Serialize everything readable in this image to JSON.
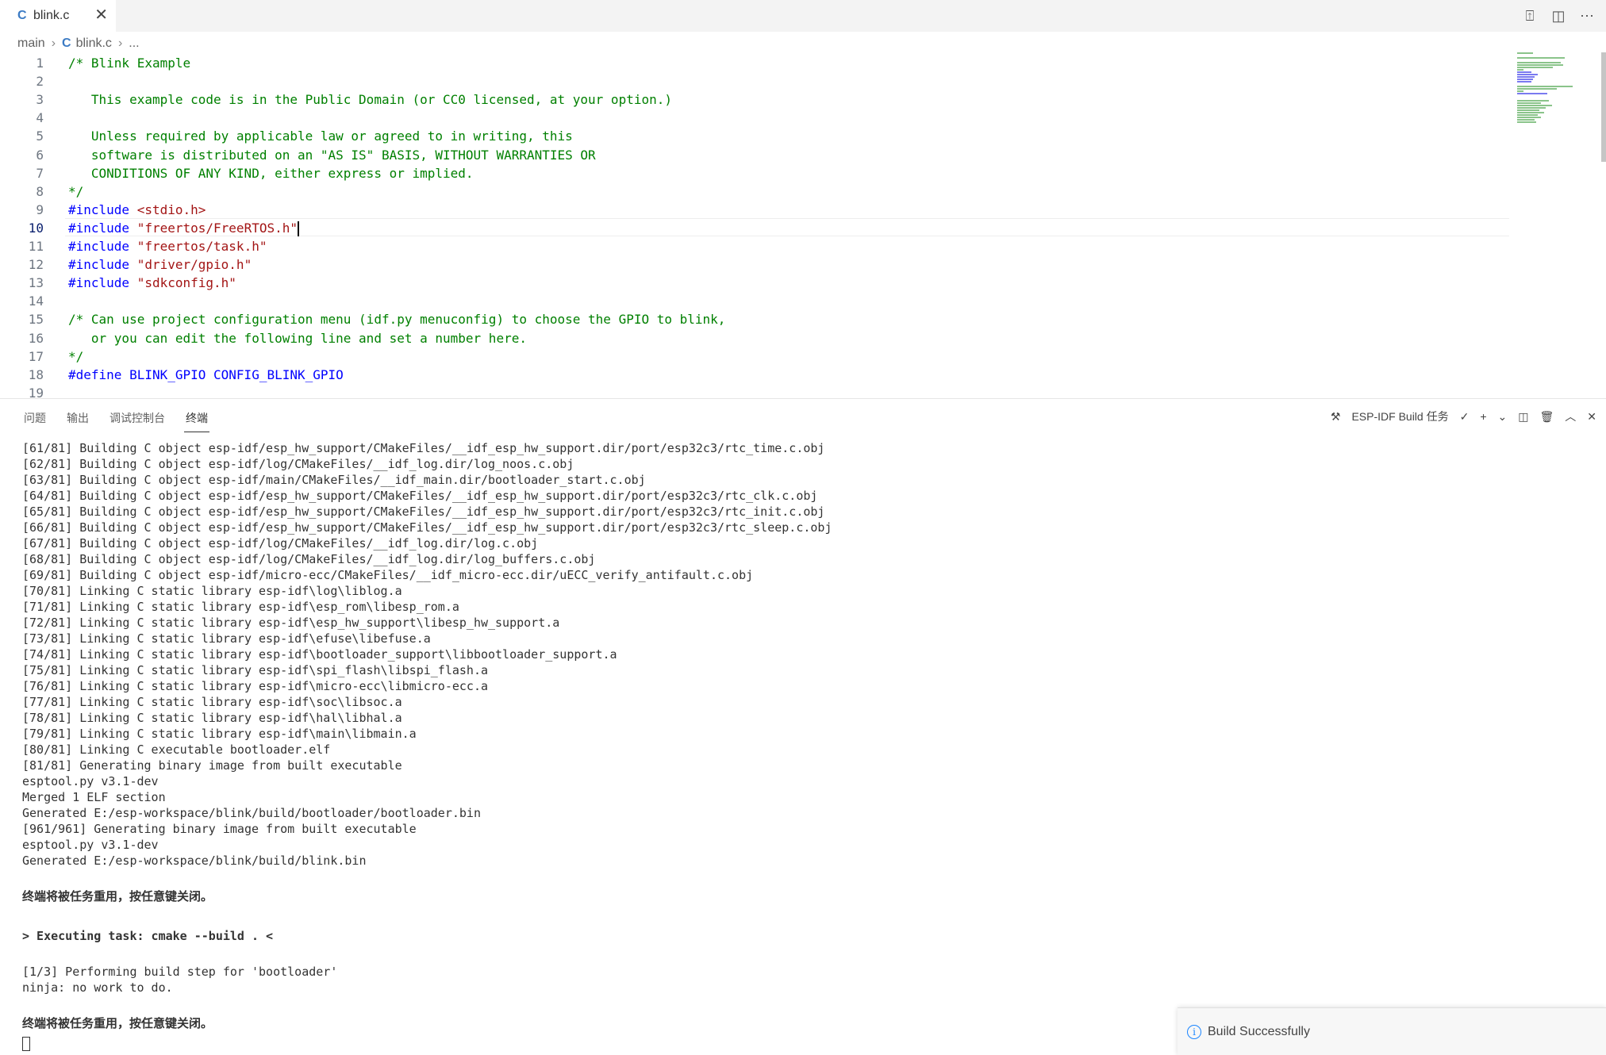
{
  "tab": {
    "icon": "C",
    "label": "blink.c",
    "close": "✕"
  },
  "top_actions": [
    "⍐",
    "◫",
    "⋯"
  ],
  "breadcrumb": {
    "folder": "main",
    "file_icon": "C",
    "file": "blink.c",
    "rest": "..."
  },
  "editor": {
    "lines": [
      {
        "n": "1",
        "text": "/* Blink Example",
        "kind": "comment"
      },
      {
        "n": "2",
        "text": "",
        "kind": "comment"
      },
      {
        "n": "3",
        "text": "   This example code is in the Public Domain (or CC0 licensed, at your option.)",
        "kind": "comment"
      },
      {
        "n": "4",
        "text": "",
        "kind": "comment"
      },
      {
        "n": "5",
        "text": "   Unless required by applicable law or agreed to in writing, this",
        "kind": "comment"
      },
      {
        "n": "6",
        "text": "   software is distributed on an \"AS IS\" BASIS, WITHOUT WARRANTIES OR",
        "kind": "comment"
      },
      {
        "n": "7",
        "text": "   CONDITIONS OF ANY KIND, either express or implied.",
        "kind": "comment"
      },
      {
        "n": "8",
        "text": "*/",
        "kind": "comment"
      },
      {
        "n": "9",
        "pre": "#include ",
        "arg": "<stdio.h>",
        "kind": "include"
      },
      {
        "n": "10",
        "pre": "#include ",
        "arg": "\"freertos/FreeRTOS.h\"",
        "kind": "include",
        "active": true
      },
      {
        "n": "11",
        "pre": "#include ",
        "arg": "\"freertos/task.h\"",
        "kind": "include"
      },
      {
        "n": "12",
        "pre": "#include ",
        "arg": "\"driver/gpio.h\"",
        "kind": "include"
      },
      {
        "n": "13",
        "pre": "#include ",
        "arg": "\"sdkconfig.h\"",
        "kind": "include"
      },
      {
        "n": "14",
        "text": "",
        "kind": "plain"
      },
      {
        "n": "15",
        "text": "/* Can use project configuration menu (idf.py menuconfig) to choose the GPIO to blink,",
        "kind": "comment"
      },
      {
        "n": "16",
        "text": "   or you can edit the following line and set a number here.",
        "kind": "comment"
      },
      {
        "n": "17",
        "text": "*/",
        "kind": "comment"
      },
      {
        "n": "18",
        "text": "#define BLINK_GPIO CONFIG_BLINK_GPIO",
        "kind": "define"
      },
      {
        "n": "19",
        "text": "",
        "kind": "plain"
      }
    ]
  },
  "panel": {
    "tabs": [
      "问题",
      "输出",
      "调试控制台",
      "终端"
    ],
    "active_tab": 3,
    "task_label": "ESP-IDF Build 任务",
    "actions": [
      "✓",
      "+",
      "⌄",
      "◫",
      "🗑",
      "︿",
      "✕"
    ]
  },
  "terminal": {
    "lines": [
      {
        "t": "[61/81] Building C object esp-idf/esp_hw_support/CMakeFiles/__idf_esp_hw_support.dir/port/esp32c3/rtc_time.c.obj"
      },
      {
        "t": "[62/81] Building C object esp-idf/log/CMakeFiles/__idf_log.dir/log_noos.c.obj"
      },
      {
        "t": "[63/81] Building C object esp-idf/main/CMakeFiles/__idf_main.dir/bootloader_start.c.obj"
      },
      {
        "t": "[64/81] Building C object esp-idf/esp_hw_support/CMakeFiles/__idf_esp_hw_support.dir/port/esp32c3/rtc_clk.c.obj"
      },
      {
        "t": "[65/81] Building C object esp-idf/esp_hw_support/CMakeFiles/__idf_esp_hw_support.dir/port/esp32c3/rtc_init.c.obj"
      },
      {
        "t": "[66/81] Building C object esp-idf/esp_hw_support/CMakeFiles/__idf_esp_hw_support.dir/port/esp32c3/rtc_sleep.c.obj"
      },
      {
        "t": "[67/81] Building C object esp-idf/log/CMakeFiles/__idf_log.dir/log.c.obj"
      },
      {
        "t": "[68/81] Building C object esp-idf/log/CMakeFiles/__idf_log.dir/log_buffers.c.obj"
      },
      {
        "t": "[69/81] Building C object esp-idf/micro-ecc/CMakeFiles/__idf_micro-ecc.dir/uECC_verify_antifault.c.obj"
      },
      {
        "t": "[70/81] Linking C static library esp-idf\\log\\liblog.a"
      },
      {
        "t": "[71/81] Linking C static library esp-idf\\esp_rom\\libesp_rom.a"
      },
      {
        "t": "[72/81] Linking C static library esp-idf\\esp_hw_support\\libesp_hw_support.a"
      },
      {
        "t": "[73/81] Linking C static library esp-idf\\efuse\\libefuse.a"
      },
      {
        "t": "[74/81] Linking C static library esp-idf\\bootloader_support\\libbootloader_support.a"
      },
      {
        "t": "[75/81] Linking C static library esp-idf\\spi_flash\\libspi_flash.a"
      },
      {
        "t": "[76/81] Linking C static library esp-idf\\micro-ecc\\libmicro-ecc.a"
      },
      {
        "t": "[77/81] Linking C static library esp-idf\\soc\\libsoc.a"
      },
      {
        "t": "[78/81] Linking C static library esp-idf\\hal\\libhal.a"
      },
      {
        "t": "[79/81] Linking C static library esp-idf\\main\\libmain.a"
      },
      {
        "t": "[80/81] Linking C executable bootloader.elf"
      },
      {
        "t": "[81/81] Generating binary image from built executable"
      },
      {
        "t": "esptool.py v3.1-dev"
      },
      {
        "t": "Merged 1 ELF section"
      },
      {
        "t": "Generated E:/esp-workspace/blink/build/bootloader/bootloader.bin"
      },
      {
        "t": "[961/961] Generating binary image from built executable"
      },
      {
        "t": "esptool.py v3.1-dev"
      },
      {
        "t": "Generated E:/esp-workspace/blink/build/blink.bin"
      },
      {
        "t": ""
      },
      {
        "t": "终端将被任务重用，按任意键关闭。",
        "bold": true
      },
      {
        "t": ""
      },
      {
        "t": "> Executing task: cmake --build . <",
        "bold": true
      },
      {
        "t": ""
      },
      {
        "t": "[1/3] Performing build step for 'bootloader'"
      },
      {
        "t": "ninja: no work to do."
      },
      {
        "t": ""
      },
      {
        "t": "终端将被任务重用，按任意键关闭。",
        "bold": true
      }
    ]
  },
  "toast": {
    "icon": "i",
    "message": "Build Successfully"
  },
  "colors": {
    "comment": "#008000",
    "keyword": "#0000ff",
    "string": "#a31515",
    "accent": "#1a85ff"
  }
}
